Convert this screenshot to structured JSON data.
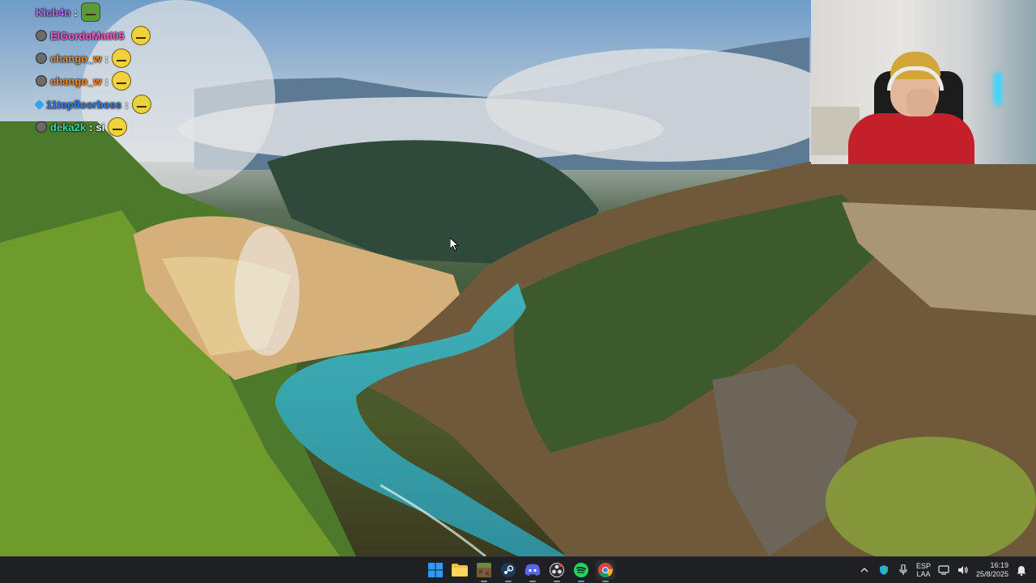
{
  "chat": [
    {
      "badge": "none",
      "user": "Kich4n",
      "user_color": "#b46cff",
      "separator": ":",
      "message": "",
      "emote": "frog-emote"
    },
    {
      "badge": "grey-circle",
      "user": "ElGordoMati05",
      "user_color": "#ff5ad0",
      "separator": "",
      "message": "",
      "emote": "neutral-face-emote"
    },
    {
      "badge": "grey-circle",
      "user": "chango_w",
      "user_color": "#ff8a2a",
      "separator": ":",
      "message": "",
      "emote": "neutral-face-emote"
    },
    {
      "badge": "grey-circle",
      "user": "chango_w",
      "user_color": "#ff8a2a",
      "separator": ":",
      "message": "",
      "emote": "neutral-face-emote"
    },
    {
      "badge": "diamond",
      "user": "11topfloorboss",
      "user_color": "#2a7dff",
      "separator": ":",
      "message": "",
      "emote": "glasses-face-emote"
    },
    {
      "badge": "grey-circle",
      "user": "deka2k",
      "user_color": "#3fd6a8",
      "separator": ":",
      "message": "si",
      "emote": "wave-face-emote"
    }
  ],
  "taskbar": {
    "apps": [
      {
        "name": "windows-start-icon"
      },
      {
        "name": "file-explorer-icon"
      },
      {
        "name": "minecraft-icon"
      },
      {
        "name": "steam-icon"
      },
      {
        "name": "discord-icon"
      },
      {
        "name": "obs-icon"
      },
      {
        "name": "spotify-icon"
      },
      {
        "name": "chrome-icon"
      }
    ],
    "language": {
      "line1": "ESP",
      "line2": "LAA"
    },
    "clock": {
      "time": "16:19",
      "date": "25/8/2025"
    }
  },
  "colors": {
    "taskbar_bg": "#1f2023",
    "accent": "#0078d4"
  }
}
